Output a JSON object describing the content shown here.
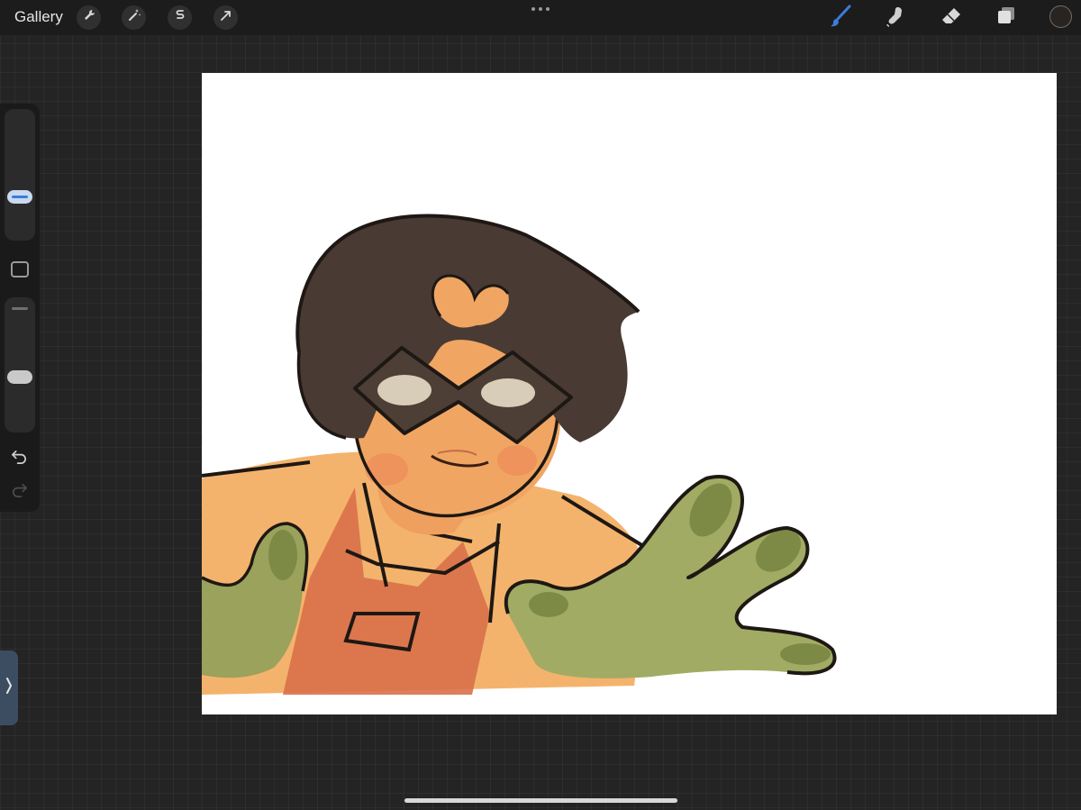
{
  "topbar": {
    "gallery_label": "Gallery",
    "left_tools": [
      "wrench-icon",
      "magic-wand-icon",
      "selection-icon",
      "transform-arrow-icon"
    ],
    "right_tools": [
      "brush-icon",
      "smudge-icon",
      "eraser-icon",
      "layers-icon"
    ],
    "active_tool": "brush-icon",
    "accent_color": "#3a7ddb",
    "current_color": "#2a2421"
  },
  "sidebar": {
    "brush_size": 0.48,
    "opacity": 0.9,
    "controls": [
      "brush-size-slider",
      "modify-button",
      "opacity-slider",
      "undo-icon",
      "redo-icon"
    ]
  },
  "canvas": {
    "background": "#ffffff",
    "artwork_colors": {
      "hair": "#4a3a34",
      "skin": "#f0a662",
      "mask": "#4d3f35",
      "hand": "#9aa25c",
      "shirt": "#d9704a",
      "outline": "#1e1814"
    }
  }
}
